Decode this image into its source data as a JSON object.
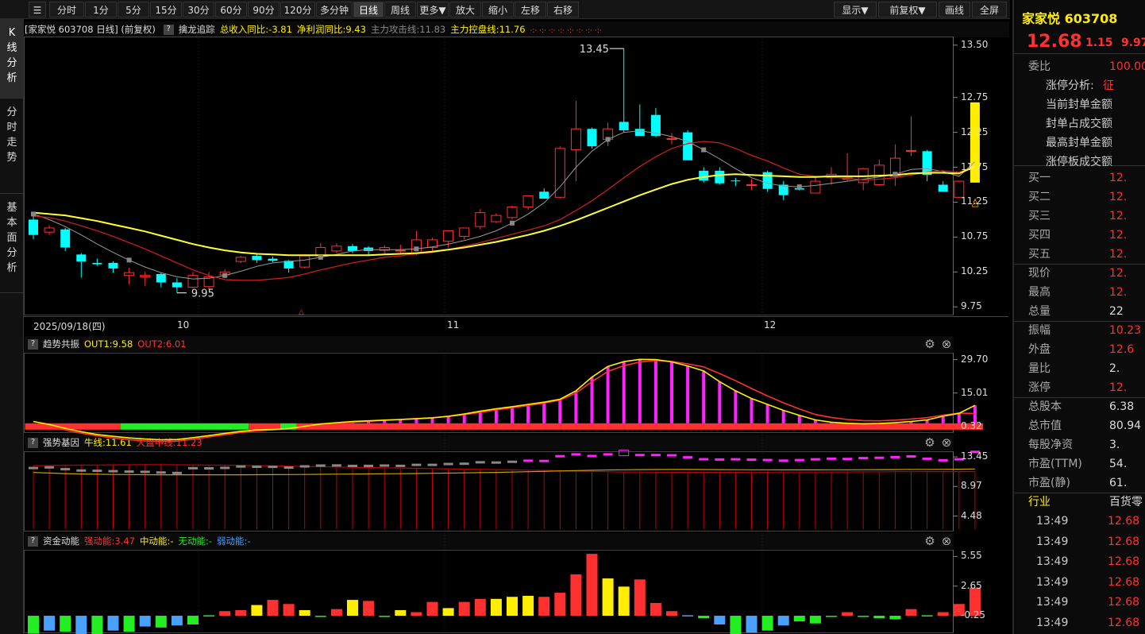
{
  "toolbar": {
    "items": [
      "分时",
      "1分",
      "5分",
      "15分",
      "30分",
      "60分",
      "90分",
      "120分",
      "多分钟",
      "日线",
      "周线",
      "更多▼",
      "放大",
      "缩小",
      "左移",
      "右移"
    ],
    "active": "日线",
    "right": [
      "显示▼",
      "前复权▼",
      "画线",
      "全屏"
    ]
  },
  "left_tabs": [
    "K线分析",
    "分时走势",
    "基本面分析"
  ],
  "main_header": {
    "title": "[家家悦 603708 日线] (前复权)",
    "indicator": "擒龙追踪",
    "income_yoy": "总收入同比:-3.81",
    "profit_yoy": "净利润同比:9.43",
    "attack": "主力攻击线:11.83",
    "control": "主力控盘线:11.76",
    "dots": "·:· ·:· ·:· ·:· ·:· ·:· ·:· ·:·"
  },
  "sub1": {
    "name": "趋势共振",
    "out1": "OUT1:9.58",
    "out2": "OUT2:6.01"
  },
  "sub2": {
    "name": "强势基因",
    "bull": "牛线:11.61",
    "mid": "大盘中线:11.23"
  },
  "sub3": {
    "name": "资金动能",
    "strong": "强动能:3.47",
    "mid": "中动能:-",
    "none": "无动能:-",
    "weak": "弱动能:-"
  },
  "date_axis": {
    "first": "2025/09/18(四)",
    "labels": [
      "10",
      "11",
      "12"
    ]
  },
  "colors": {
    "up": "#ff3030",
    "down": "#00ffff",
    "ma_fast": "#c81d1d",
    "ma_slow": "#ffff30",
    "grey_ma": "#999999",
    "magenta": "#ff22ff",
    "green": "#22ee22",
    "yellow": "#ffee00",
    "blue": "#4aa0ff",
    "bg": "#000000",
    "grid": "#3a3a3a"
  },
  "chart_data": [
    {
      "type": "candlestick",
      "title": "家家悦 603708 日线",
      "ylim": [
        9.65,
        13.6
      ],
      "yticks": [
        13.5,
        12.75,
        12.25,
        11.75,
        11.25,
        10.75,
        10.25,
        9.75
      ],
      "annotations": [
        "13.45",
        "9.95"
      ],
      "ohlc": [
        [
          11.0,
          11.06,
          10.72,
          10.78
        ],
        [
          10.82,
          10.92,
          10.78,
          10.88
        ],
        [
          10.86,
          10.88,
          10.55,
          10.6
        ],
        [
          10.5,
          10.52,
          10.17,
          10.4
        ],
        [
          10.38,
          10.44,
          10.34,
          10.36
        ],
        [
          10.38,
          10.4,
          10.24,
          10.3
        ],
        [
          10.2,
          10.31,
          10.07,
          10.24
        ],
        [
          10.18,
          10.25,
          10.05,
          10.2
        ],
        [
          10.22,
          10.24,
          10.03,
          10.1
        ],
        [
          10.1,
          10.16,
          9.95,
          10.03
        ],
        [
          10.03,
          10.25,
          10.02,
          10.2
        ],
        [
          10.04,
          10.25,
          10.0,
          10.18
        ],
        [
          10.21,
          10.29,
          10.16,
          10.25
        ],
        [
          10.4,
          10.48,
          10.38,
          10.46
        ],
        [
          10.48,
          10.52,
          10.38,
          10.42
        ],
        [
          10.44,
          10.47,
          10.39,
          10.41
        ],
        [
          10.41,
          10.42,
          10.24,
          10.3
        ],
        [
          10.32,
          10.5,
          10.3,
          10.48
        ],
        [
          10.48,
          10.66,
          10.46,
          10.6
        ],
        [
          10.55,
          10.66,
          10.52,
          10.62
        ],
        [
          10.62,
          10.65,
          10.52,
          10.55
        ],
        [
          10.6,
          10.62,
          10.48,
          10.55
        ],
        [
          10.56,
          10.63,
          10.51,
          10.6
        ],
        [
          10.55,
          10.64,
          10.5,
          10.56
        ],
        [
          10.52,
          10.84,
          10.49,
          10.71
        ],
        [
          10.6,
          10.74,
          10.55,
          10.71
        ],
        [
          10.69,
          10.84,
          10.6,
          10.84
        ],
        [
          10.76,
          10.88,
          10.72,
          10.88
        ],
        [
          10.9,
          11.15,
          10.86,
          11.1
        ],
        [
          10.97,
          11.09,
          10.95,
          11.06
        ],
        [
          11.03,
          11.2,
          11.0,
          11.18
        ],
        [
          11.18,
          11.35,
          11.14,
          11.34
        ],
        [
          11.4,
          11.45,
          11.3,
          11.3
        ],
        [
          11.32,
          12.05,
          11.3,
          12.02
        ],
        [
          12.0,
          12.7,
          11.55,
          12.3
        ],
        [
          12.3,
          12.32,
          12.02,
          12.05
        ],
        [
          12.15,
          12.39,
          12.05,
          12.3
        ],
        [
          12.4,
          13.45,
          12.25,
          12.28
        ],
        [
          12.3,
          12.65,
          12.2,
          12.2
        ],
        [
          12.5,
          12.6,
          12.18,
          12.2
        ],
        [
          12.15,
          12.24,
          12.08,
          12.16
        ],
        [
          12.25,
          12.28,
          11.85,
          11.85
        ],
        [
          11.7,
          11.75,
          11.53,
          11.56
        ],
        [
          11.7,
          11.75,
          11.5,
          11.52
        ],
        [
          11.56,
          11.6,
          11.48,
          11.55
        ],
        [
          11.49,
          11.58,
          11.42,
          11.5
        ],
        [
          11.68,
          11.7,
          11.4,
          11.44
        ],
        [
          11.5,
          11.55,
          11.28,
          11.35
        ],
        [
          11.45,
          11.49,
          11.42,
          11.43
        ],
        [
          11.38,
          11.62,
          11.38,
          11.55
        ],
        [
          11.6,
          11.75,
          11.5,
          11.65
        ],
        [
          11.58,
          11.95,
          11.55,
          11.6
        ],
        [
          11.53,
          11.74,
          11.42,
          11.73
        ],
        [
          11.5,
          11.86,
          11.48,
          11.78
        ],
        [
          11.62,
          12.08,
          11.48,
          11.88
        ],
        [
          11.99,
          12.48,
          11.91,
          11.99
        ],
        [
          11.98,
          12.0,
          11.55,
          11.64
        ],
        [
          11.5,
          11.55,
          11.4,
          11.4
        ],
        [
          11.32,
          11.56,
          11.31,
          11.55
        ],
        [
          11.53,
          12.68,
          11.53,
          12.68
        ]
      ],
      "ma_fast": [
        11.05,
        11.03,
        10.98,
        10.91,
        10.84,
        10.76,
        10.67,
        10.58,
        10.48,
        10.38,
        10.28,
        10.2,
        10.14,
        10.13,
        10.13,
        10.15,
        10.17,
        10.22,
        10.28,
        10.33,
        10.38,
        10.42,
        10.46,
        10.48,
        10.51,
        10.53,
        10.57,
        10.62,
        10.67,
        10.73,
        10.79,
        10.85,
        10.91,
        11.0,
        11.13,
        11.27,
        11.43,
        11.6,
        11.76,
        11.9,
        12.02,
        12.09,
        12.12,
        12.1,
        12.02,
        11.92,
        11.84,
        11.74,
        11.65,
        11.62,
        11.61,
        11.59,
        11.57,
        11.58,
        11.6,
        11.64,
        11.68,
        11.7,
        11.68,
        11.76
      ],
      "ma_slow": [
        11.1,
        11.08,
        11.06,
        11.02,
        10.98,
        10.93,
        10.88,
        10.83,
        10.77,
        10.71,
        10.65,
        10.6,
        10.56,
        10.53,
        10.51,
        10.5,
        10.49,
        10.49,
        10.49,
        10.49,
        10.49,
        10.49,
        10.5,
        10.51,
        10.52,
        10.54,
        10.57,
        10.6,
        10.64,
        10.68,
        10.73,
        10.78,
        10.84,
        10.91,
        10.99,
        11.08,
        11.17,
        11.26,
        11.35,
        11.43,
        11.51,
        11.57,
        11.61,
        11.64,
        11.65,
        11.64,
        11.63,
        11.62,
        11.61,
        11.61,
        11.62,
        11.62,
        11.62,
        11.63,
        11.64,
        11.66,
        11.67,
        11.67,
        11.66,
        11.76
      ],
      "ma_grey": [
        11.08,
        11.0,
        10.9,
        10.78,
        10.65,
        10.53,
        10.42,
        10.32,
        10.24,
        10.18,
        10.15,
        10.16,
        10.2,
        10.26,
        10.33,
        10.38,
        10.4,
        10.42,
        10.46,
        10.5,
        10.55,
        10.57,
        10.57,
        10.57,
        10.58,
        10.61,
        10.65,
        10.7,
        10.76,
        10.84,
        10.95,
        11.08,
        11.24,
        11.47,
        11.75,
        11.98,
        12.15,
        12.25,
        12.27,
        12.24,
        12.19,
        12.12,
        12.0,
        11.87,
        11.73,
        11.6,
        11.52,
        11.48,
        11.47,
        11.49,
        11.52,
        11.55,
        11.58,
        11.61,
        11.65,
        11.72,
        11.73,
        11.69,
        11.62,
        11.83
      ]
    },
    {
      "type": "bar",
      "title": "趋势共振",
      "ylim": [
        -1.5,
        32
      ],
      "yticks": [
        29.7,
        15.01,
        0.32
      ],
      "series": [
        {
          "name": "OUT1",
          "values": [
            2.5,
            1.2,
            -0.5,
            -2,
            -3.2,
            -4,
            -4.7,
            -5.2,
            -5.5,
            -5.4,
            -4.6,
            -3.7,
            -2.7,
            -1.8,
            -1.2,
            -1,
            -0.6,
            0.4,
            1.4,
            2,
            2.5,
            2.8,
            3.1,
            3.4,
            3.7,
            4.1,
            4.8,
            5.8,
            7,
            8.1,
            9,
            10,
            11,
            12.3,
            16,
            22,
            26.7,
            28.8,
            29.8,
            29.7,
            28.7,
            26.9,
            24.7,
            20,
            16,
            12.6,
            10,
            7.4,
            5.2,
            3.2,
            2.2,
            1.7,
            1.5,
            1.6,
            2,
            2.5,
            3.2,
            4.8,
            6.1,
            9.58
          ]
        },
        {
          "name": "OUT2",
          "values": [
            1.5,
            0.3,
            -1.2,
            -2.6,
            -3.8,
            -4.7,
            -5.5,
            -6,
            -6.3,
            -6.1,
            -5.3,
            -4.3,
            -3.3,
            -2.3,
            -1.6,
            -1.1,
            -0.7,
            0.1,
            0.9,
            1.6,
            2.2,
            2.6,
            3,
            3.4,
            3.8,
            4.2,
            4.7,
            5.5,
            6.5,
            7.6,
            8.5,
            9.5,
            10.6,
            11.9,
            15,
            20,
            24.5,
            27,
            28.6,
            29.3,
            28.9,
            27.8,
            26.5,
            23.6,
            20.4,
            17,
            13.7,
            10.7,
            8,
            5.6,
            4.3,
            3.4,
            2.9,
            2.8,
            3.1,
            3.6,
            4.2,
            5.3,
            6.2,
            6.01
          ]
        }
      ]
    },
    {
      "type": "bar",
      "title": "强势基因",
      "ylim": [
        2.5,
        14.3
      ],
      "yticks": [
        13.45,
        8.97,
        4.48
      ],
      "series": [
        {
          "name": "牛线",
          "values": [
            11.08,
            11.0,
            10.92,
            10.86,
            10.82,
            10.79,
            10.77,
            10.75,
            10.74,
            10.74,
            10.74,
            10.74,
            10.74,
            10.74,
            10.75,
            10.76,
            10.77,
            10.79,
            10.81,
            10.83,
            10.85,
            10.87,
            10.89,
            10.91,
            10.93,
            10.96,
            10.99,
            11.02,
            11.06,
            11.1,
            11.15,
            11.2,
            11.25,
            11.31,
            11.37,
            11.42,
            11.47,
            11.5,
            11.52,
            11.53,
            11.54,
            11.54,
            11.53,
            11.52,
            11.51,
            11.5,
            11.49,
            11.48,
            11.48,
            11.48,
            11.49,
            11.5,
            11.51,
            11.52,
            11.53,
            11.55,
            11.56,
            11.57,
            11.58,
            11.61
          ]
        },
        {
          "name": "大盘中线",
          "values": [
            12.12,
            12.15,
            12.18,
            12.2,
            12.22,
            12.24,
            12.25,
            12.26,
            12.26,
            12.25,
            12.24,
            12.22,
            12.19,
            12.16,
            12.12,
            12.08,
            12.04,
            12.0,
            11.96,
            11.92,
            11.88,
            11.84,
            11.8,
            11.76,
            11.72,
            11.68,
            11.64,
            11.6,
            11.56,
            11.52,
            11.48,
            11.44,
            11.4,
            11.36,
            11.3,
            11.25,
            11.2,
            11.16,
            11.14,
            11.13,
            11.12,
            11.12,
            11.12,
            11.12,
            11.12,
            11.13,
            11.13,
            11.14,
            11.14,
            11.15,
            11.16,
            11.17,
            11.18,
            11.19,
            11.2,
            11.21,
            11.22,
            11.22,
            11.22,
            11.23
          ]
        }
      ]
    },
    {
      "type": "bar",
      "title": "资金动能",
      "ylim": [
        -1.8,
        6.2
      ],
      "yticks": [
        5.55,
        2.65,
        -0.25
      ],
      "values": [
        -2,
        -1.7,
        -1.8,
        -3,
        -2.1,
        -1.7,
        -1.8,
        -1.3,
        -1.4,
        -1.2,
        -1.1,
        -0.2,
        0.2,
        0.3,
        0.8,
        1.3,
        0.9,
        0.3,
        -0.3,
        0.4,
        1.3,
        1.2,
        -0.3,
        0.3,
        0.1,
        1.1,
        0.5,
        1.1,
        1.4,
        1.4,
        1.6,
        1.7,
        1.6,
        2,
        3.8,
        5.8,
        3.4,
        2.6,
        3.3,
        1,
        0.2,
        -0.2,
        -0.5,
        -1.1,
        -2.6,
        -1.9,
        -1.7,
        -1.2,
        -0.8,
        -1.0,
        -0.3,
        0.1,
        -0.3,
        -0.5,
        -0.6,
        0.4,
        -0.2,
        0.1,
        0.9,
        2.5,
        -0.4,
        -1.9,
        -1.2,
        3.47
      ]
    }
  ],
  "right_panel": {
    "name": "家家悦 603708",
    "price": "12.68",
    "change": "1.15",
    "pct": "9.97",
    "rows": [
      {
        "label": "委比",
        "value": "100.00"
      },
      {
        "label": "涨停分析:",
        "value": "征"
      },
      {
        "label": "当前封单金额",
        "value": ""
      },
      {
        "label": "封单占成交额",
        "value": ""
      },
      {
        "label": "最高封单金额",
        "value": ""
      },
      {
        "label": "涨停板成交额",
        "value": ""
      },
      {
        "label": "买一",
        "value": "12."
      },
      {
        "label": "买二",
        "value": "12."
      },
      {
        "label": "买三",
        "value": "12."
      },
      {
        "label": "买四",
        "value": "12."
      },
      {
        "label": "买五",
        "value": "12."
      },
      {
        "label": "现价",
        "value": "12."
      },
      {
        "label": "最高",
        "value": "12."
      },
      {
        "label": "总量",
        "value": "22"
      },
      {
        "label": "振幅",
        "value": "10.23"
      },
      {
        "label": "外盘",
        "value": "12.6"
      },
      {
        "label": "量比",
        "value": "2."
      },
      {
        "label": "涨停",
        "value": "12."
      },
      {
        "label": "总股本",
        "value": "6.38"
      },
      {
        "label": "总市值",
        "value": "80.94"
      },
      {
        "label": "每股净资",
        "value": "3."
      },
      {
        "label": "市盈(TTM)",
        "value": "54."
      },
      {
        "label": "市盈(静)",
        "value": "61."
      },
      {
        "label": "行业",
        "value": "百货零"
      }
    ],
    "ticks": [
      {
        "time": "13:49",
        "price": "12.68"
      },
      {
        "time": "13:49",
        "price": "12.68"
      },
      {
        "time": "13:49",
        "price": "12.68"
      },
      {
        "time": "13:49",
        "price": "12.68"
      },
      {
        "time": "13:49",
        "price": "12.68"
      },
      {
        "time": "13:49",
        "price": "12.68"
      }
    ]
  }
}
